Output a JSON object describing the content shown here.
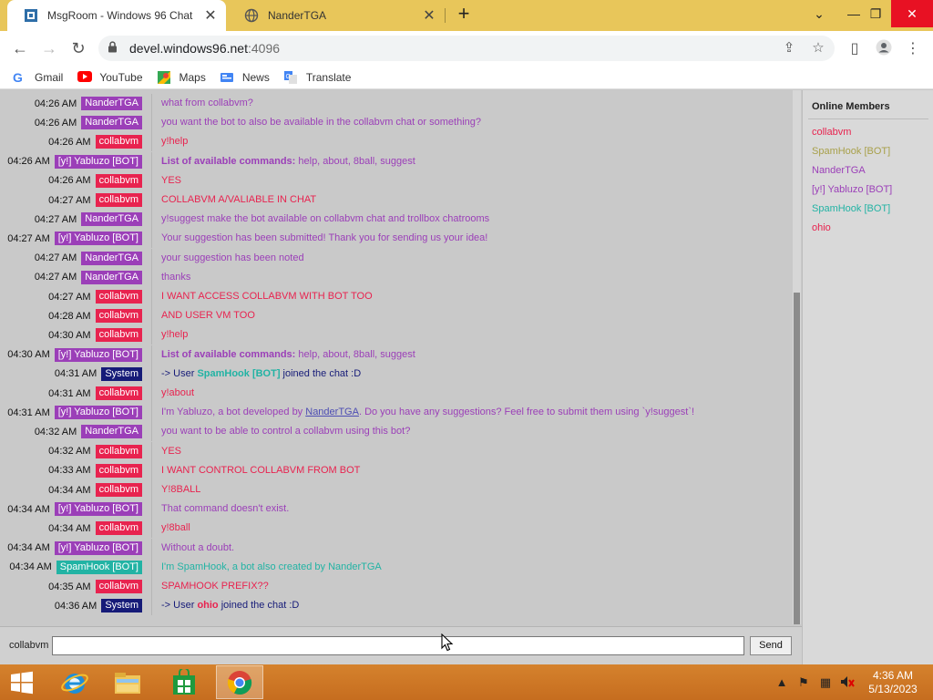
{
  "browser": {
    "tabs": [
      {
        "title": "MsgRoom - Windows 96 Chat",
        "active": true
      },
      {
        "title": "NanderTGA",
        "active": false
      }
    ],
    "url_host": "devel.windows96.net",
    "url_port": ":4096",
    "bookmarks": [
      {
        "label": "Gmail",
        "icon": "google-icon"
      },
      {
        "label": "YouTube",
        "icon": "youtube-icon"
      },
      {
        "label": "Maps",
        "icon": "maps-icon"
      },
      {
        "label": "News",
        "icon": "news-icon"
      },
      {
        "label": "Translate",
        "icon": "translate-icon"
      }
    ]
  },
  "colors": {
    "NanderTGA": "#9b3fb8",
    "collabvm": "#e8234f",
    "Yabluzo": "#9b3fb8",
    "System": "#161b78",
    "SpamHook": "#22b3a4",
    "ohio": "#e8234f",
    "link": "#4d4db3"
  },
  "messages": [
    {
      "time": "04:26 AM",
      "user": "NanderTGA",
      "color": "#9b3fb8",
      "text": "what from collabvm?",
      "text_color": "#9b3fb8"
    },
    {
      "time": "04:26 AM",
      "user": "NanderTGA",
      "color": "#9b3fb8",
      "text": "you want the bot to also be available in the collabvm chat or something?",
      "text_color": "#9b3fb8"
    },
    {
      "time": "04:26 AM",
      "user": "collabvm",
      "color": "#e8234f",
      "text": "y!help",
      "text_color": "#e8234f"
    },
    {
      "time": "04:26 AM",
      "user": "[y!] Yabluzo [BOT]",
      "color": "#9b3fb8",
      "bold": "List of available commands:",
      "text": " help, about, 8ball, suggest",
      "text_color": "#9b3fb8"
    },
    {
      "time": "04:26 AM",
      "user": "collabvm",
      "color": "#e8234f",
      "text": "YES",
      "text_color": "#e8234f"
    },
    {
      "time": "04:27 AM",
      "user": "collabvm",
      "color": "#e8234f",
      "text": "COLLABVM A/VALIABLE IN CHAT",
      "text_color": "#e8234f"
    },
    {
      "time": "04:27 AM",
      "user": "NanderTGA",
      "color": "#9b3fb8",
      "text": "y!suggest make the bot available on collabvm chat and trollbox chatrooms",
      "text_color": "#9b3fb8"
    },
    {
      "time": "04:27 AM",
      "user": "[y!] Yabluzo [BOT]",
      "color": "#9b3fb8",
      "text": "Your suggestion has been submitted! Thank you for sending us your idea!",
      "text_color": "#9b3fb8"
    },
    {
      "time": "04:27 AM",
      "user": "NanderTGA",
      "color": "#9b3fb8",
      "text": "your suggestion has been noted",
      "text_color": "#9b3fb8"
    },
    {
      "time": "04:27 AM",
      "user": "NanderTGA",
      "color": "#9b3fb8",
      "text": "thanks",
      "text_color": "#9b3fb8"
    },
    {
      "time": "04:27 AM",
      "user": "collabvm",
      "color": "#e8234f",
      "text": "I WANT ACCESS COLLABVM WITH BOT TOO",
      "text_color": "#e8234f"
    },
    {
      "time": "04:28 AM",
      "user": "collabvm",
      "color": "#e8234f",
      "text": "AND USER VM TOO",
      "text_color": "#e8234f"
    },
    {
      "time": "04:30 AM",
      "user": "collabvm",
      "color": "#e8234f",
      "text": "y!help",
      "text_color": "#e8234f"
    },
    {
      "time": "04:30 AM",
      "user": "[y!] Yabluzo [BOT]",
      "color": "#9b3fb8",
      "bold": "List of available commands:",
      "text": " help, about, 8ball, suggest",
      "text_color": "#9b3fb8"
    },
    {
      "time": "04:31 AM",
      "user": "System",
      "color": "#161b78",
      "system": true,
      "pre": "-> User ",
      "name": "SpamHook [BOT]",
      "name_color": "#22b3a4",
      "text": " joined the chat :D",
      "text_color": "#161b78"
    },
    {
      "time": "04:31 AM",
      "user": "collabvm",
      "color": "#e8234f",
      "text": "y!about",
      "text_color": "#e8234f"
    },
    {
      "time": "04:31 AM",
      "user": "[y!] Yabluzo [BOT]",
      "color": "#9b3fb8",
      "pre": "I'm Yabluzo, a bot developed by ",
      "link": "NanderTGA",
      "text": ". Do you have any suggestions? Feel free to submit them using `y!suggest`!",
      "text_color": "#9b3fb8"
    },
    {
      "time": "04:32 AM",
      "user": "NanderTGA",
      "color": "#9b3fb8",
      "text": "you want to be able to control a collabvm using this bot?",
      "text_color": "#9b3fb8"
    },
    {
      "time": "04:32 AM",
      "user": "collabvm",
      "color": "#e8234f",
      "text": "YES",
      "text_color": "#e8234f"
    },
    {
      "time": "04:33 AM",
      "user": "collabvm",
      "color": "#e8234f",
      "text": "I WANT CONTROL COLLABVM FROM BOT",
      "text_color": "#e8234f"
    },
    {
      "time": "04:34 AM",
      "user": "collabvm",
      "color": "#e8234f",
      "text": "Y!8BALL",
      "text_color": "#e8234f"
    },
    {
      "time": "04:34 AM",
      "user": "[y!] Yabluzo [BOT]",
      "color": "#9b3fb8",
      "text": "That command doesn't exist.",
      "text_color": "#9b3fb8"
    },
    {
      "time": "04:34 AM",
      "user": "collabvm",
      "color": "#e8234f",
      "text": "y!8ball",
      "text_color": "#e8234f"
    },
    {
      "time": "04:34 AM",
      "user": "[y!] Yabluzo [BOT]",
      "color": "#9b3fb8",
      "text": "Without a doubt.",
      "text_color": "#9b3fb8"
    },
    {
      "time": "04:34 AM",
      "user": "SpamHook [BOT]",
      "color": "#22b3a4",
      "text": "I'm SpamHook, a bot also created by NanderTGA",
      "text_color": "#22b3a4"
    },
    {
      "time": "04:35 AM",
      "user": "collabvm",
      "color": "#e8234f",
      "text": "SPAMHOOK PREFIX??",
      "text_color": "#e8234f"
    },
    {
      "time": "04:36 AM",
      "user": "System",
      "color": "#161b78",
      "system": true,
      "pre": "-> User ",
      "name": "ohio",
      "name_color": "#e8234f",
      "text": " joined the chat :D",
      "text_color": "#161b78"
    }
  ],
  "members": {
    "title": "Online Members",
    "list": [
      {
        "name": "collabvm",
        "color": "#e8234f"
      },
      {
        "name": "SpamHook [BOT]",
        "color": "#a8a04a"
      },
      {
        "name": "NanderTGA",
        "color": "#9b3fb8"
      },
      {
        "name": "[y!] Yabluzo [BOT]",
        "color": "#9b3fb8"
      },
      {
        "name": "SpamHook [BOT]",
        "color": "#22b3a4"
      },
      {
        "name": "ohio",
        "color": "#e8234f"
      }
    ]
  },
  "input": {
    "username": "collabvm",
    "value": "",
    "send_label": "Send"
  },
  "taskbar": {
    "time": "4:36 AM",
    "date": "5/13/2023"
  }
}
